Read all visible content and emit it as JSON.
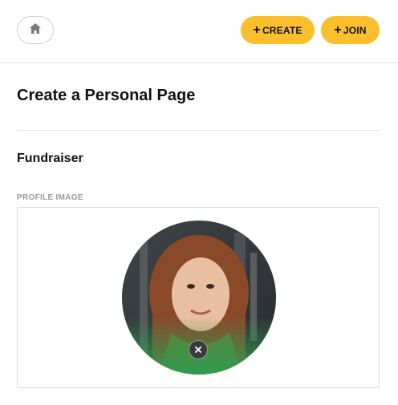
{
  "header": {
    "home_icon": "home-icon",
    "create_label": "CREATE",
    "join_label": "JOIN",
    "plus_glyph": "+",
    "accent_color": "#fbbf2d"
  },
  "main": {
    "page_title": "Create a Personal Page",
    "section_title": "Fundraiser",
    "profile_image": {
      "label": "PROFILE IMAGE",
      "remove_icon": "close-icon",
      "overlay_color": "#2e9b4f"
    }
  }
}
